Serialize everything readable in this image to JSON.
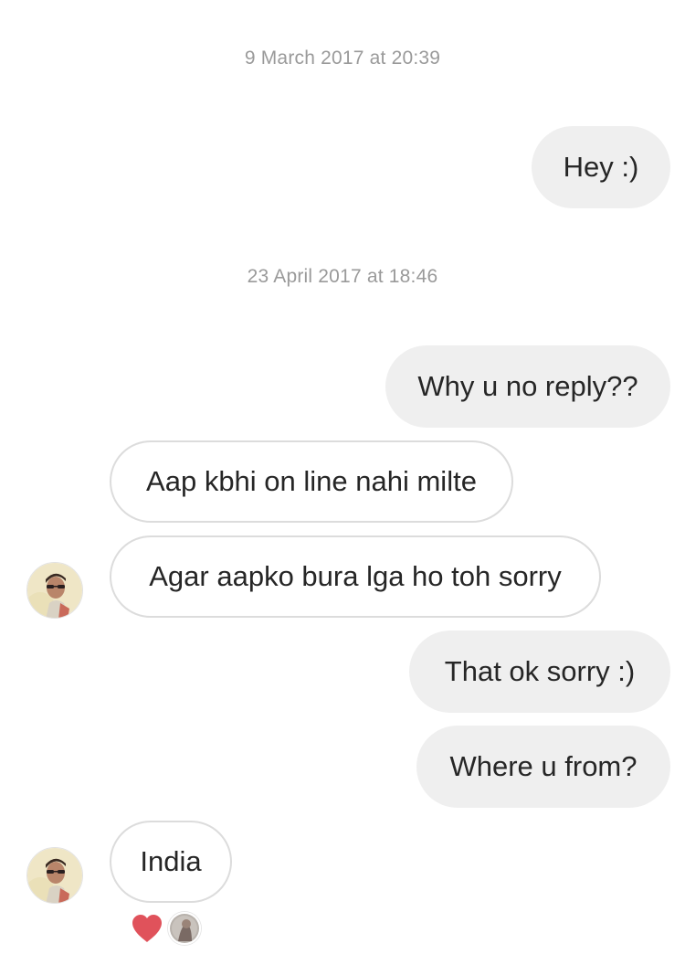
{
  "conversation": {
    "timestamps": [
      "9 March 2017 at 20:39",
      "23 April 2017 at 18:46"
    ],
    "messages": [
      {
        "direction": "outgoing",
        "text": "Hey :)"
      },
      {
        "direction": "outgoing",
        "text": "Why u no reply??"
      },
      {
        "direction": "incoming",
        "text": "Aap kbhi on line nahi milte"
      },
      {
        "direction": "incoming",
        "text": "Agar aapko bura lga ho toh sorry"
      },
      {
        "direction": "outgoing",
        "text": "That ok sorry :)"
      },
      {
        "direction": "outgoing",
        "text": "Where u from?"
      },
      {
        "direction": "incoming",
        "text": "India",
        "reaction": "heart-icon"
      }
    ]
  },
  "colors": {
    "outgoing_bubble": "#efefef",
    "incoming_border": "#dcdcdc",
    "text": "#262626",
    "timestamp": "#9a9a9a",
    "reaction_heart": "#e0525b"
  }
}
